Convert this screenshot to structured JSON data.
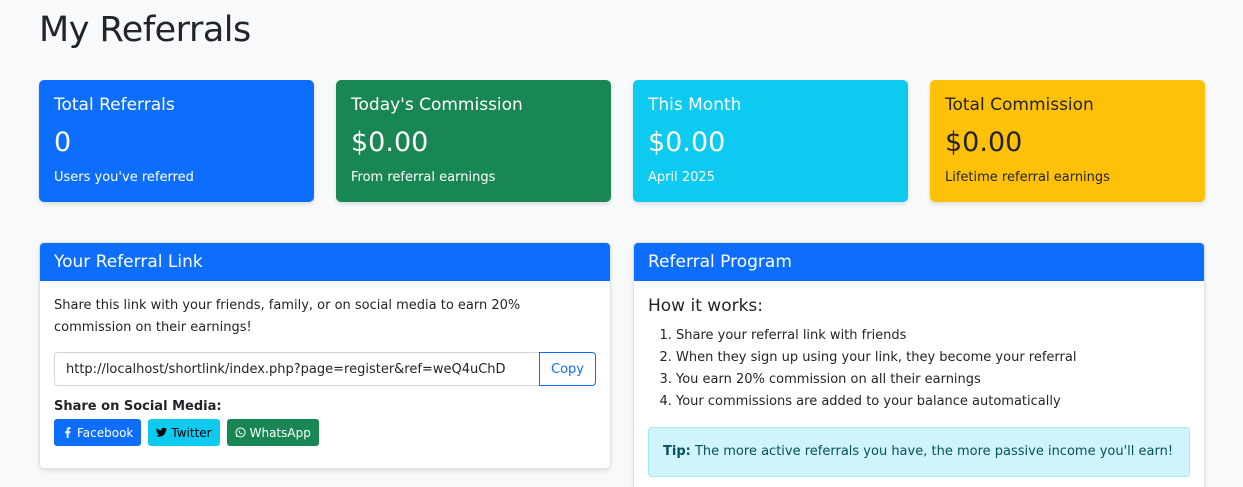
{
  "page_title": "My Referrals",
  "stats": [
    {
      "title": "Total Referrals",
      "value": "0",
      "sub": "Users you've referred",
      "color": "#0d6efd"
    },
    {
      "title": "Today's Commission",
      "value": "$0.00",
      "sub": "From referral earnings",
      "color": "#198754"
    },
    {
      "title": "This Month",
      "value": "$0.00",
      "sub": "April 2025",
      "color": "#0dcaf0"
    },
    {
      "title": "Total Commission",
      "value": "$0.00",
      "sub": "Lifetime referral earnings",
      "color": "#ffc107"
    }
  ],
  "referral_link": {
    "header": "Your Referral Link",
    "description": "Share this link with your friends, family, or on social media to earn 20% commission on their earnings!",
    "url": "http://localhost/shortlink/index.php?page=register&ref=weQ4uChD",
    "copy_label": "Copy",
    "share_label": "Share on Social Media:",
    "share_buttons": {
      "facebook": "Facebook",
      "twitter": "Twitter",
      "whatsapp": "WhatsApp"
    }
  },
  "program": {
    "header": "Referral Program",
    "how_title": "How it works:",
    "steps": [
      "Share your referral link with friends",
      "When they sign up using your link, they become your referral",
      "You earn 20% commission on all their earnings",
      "Your commissions are added to your balance automatically"
    ],
    "tip_label": "Tip:",
    "tip_text": " The more active referrals you have, the more passive income you'll earn!"
  }
}
